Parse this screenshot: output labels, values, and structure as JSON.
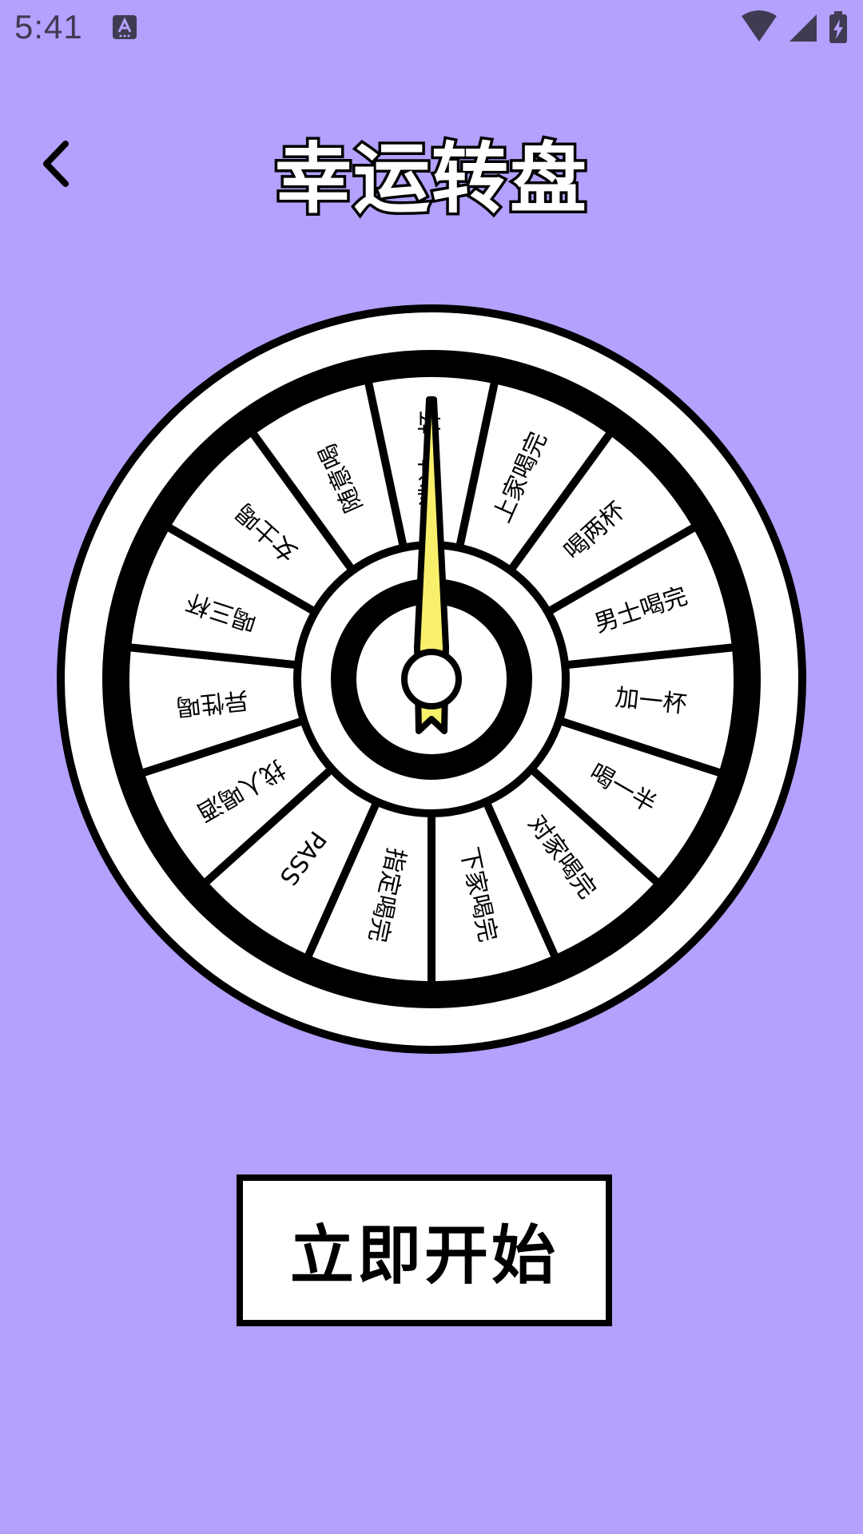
{
  "status_bar": {
    "time": "5:41"
  },
  "header": {
    "title": "幸运转盘"
  },
  "wheel": {
    "segments": [
      "逃过一杯",
      "上家喝完",
      "喝两杯",
      "男士喝完",
      "加一杯",
      "喝一半",
      "对家喝完",
      "下家喝完",
      "指定喝完",
      "PASS",
      "找人喝酒",
      "异性喝",
      "喝三杯",
      "女士喝",
      "随意喝"
    ],
    "colors": {
      "pointer": "#F8F06A",
      "segment_fill": "#FFFFFF",
      "outline": "#000000"
    }
  },
  "start_button": {
    "label": "立即开始"
  },
  "colors": {
    "background": "#B4A0FD",
    "button_shadow": "#7A5CF0"
  }
}
